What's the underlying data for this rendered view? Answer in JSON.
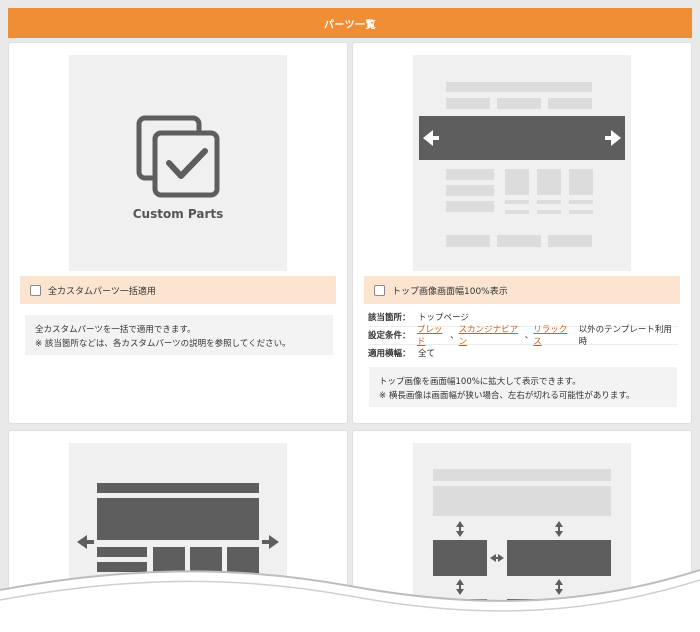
{
  "header": {
    "title": "パーツ一覧"
  },
  "cards": [
    {
      "thumb_label": "Custom Parts",
      "option_label": "全カスタムパーツ一括適用",
      "desc_lines": [
        "全カスタムパーツを一括で適用できます。",
        "※ 該当箇所などは、各カスタムパーツの説明を参照してください。"
      ]
    },
    {
      "option_label": "トップ画像画面幅100%表示",
      "meta": {
        "location_key": "該当箇所：",
        "location_val": "トップページ",
        "cond_key": "設定条件：",
        "cond_links": [
          "ブレッド",
          "スカンジナビアン",
          "リラックス"
        ],
        "cond_sep": "、",
        "cond_tail": "以外のテンプレート利用時",
        "width_key": "適用横幅：",
        "width_val": "全て"
      },
      "desc_lines": [
        "トップ画像を画面幅100%に拡大して表示できます。",
        "※ 横長画像は画面幅が狭い場合、左右が切れる可能性があります。"
      ]
    }
  ],
  "colors": {
    "accent": "#ef8e35",
    "option_bg": "#fbe5d1",
    "link": "#c8641a"
  }
}
